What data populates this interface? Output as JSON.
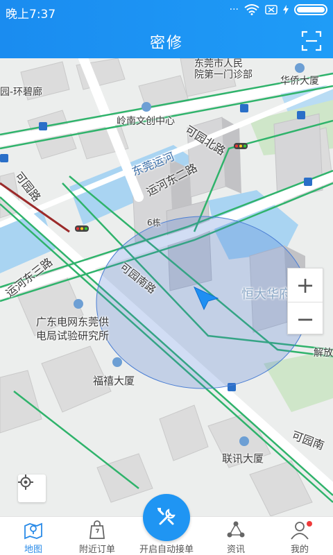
{
  "status_bar": {
    "time": "晚上7:37",
    "dots": "···"
  },
  "title_bar": {
    "title": "密修"
  },
  "map": {
    "labels": {
      "hospital": "东莞市人民\n院第一门诊部",
      "huaqiao": "华侨大厦",
      "bilang": "园-环碧廊",
      "lingnan": "岭南文创中心",
      "keyuan_north": "可园北路",
      "dongguan_canal": "东莞运河",
      "canal_east2": "运河东二路",
      "keyuan_road": "可园路",
      "building6": "6栋",
      "canal_east3": "运河东三路",
      "keyuan_south": "可园南路",
      "hengda": "恒大华府",
      "grid_institute": "广东电网东莞供\n电局试验研究所",
      "jiefang": "解放",
      "fuxi": "福禧大厦",
      "keyuan_south2": "可园南",
      "lianxun": "联讯大厦"
    }
  },
  "zoom": {
    "plus": "+",
    "minus": "−"
  },
  "bottom_nav": {
    "items": [
      {
        "label": "地图",
        "icon": "map-icon",
        "active": true
      },
      {
        "label": "附近订单",
        "icon": "order-bag-icon"
      },
      {
        "label": "开启自动接单",
        "icon": "wrench-screwdriver-icon"
      },
      {
        "label": "资讯",
        "icon": "share-nodes-icon"
      },
      {
        "label": "我的",
        "icon": "user-icon"
      }
    ]
  },
  "colors": {
    "primary": "#1f95f3",
    "active_nav": "#2a8be8",
    "road_green": "#2fb36b",
    "water": "#a9d4f2",
    "badge": "#ef3b3b"
  }
}
